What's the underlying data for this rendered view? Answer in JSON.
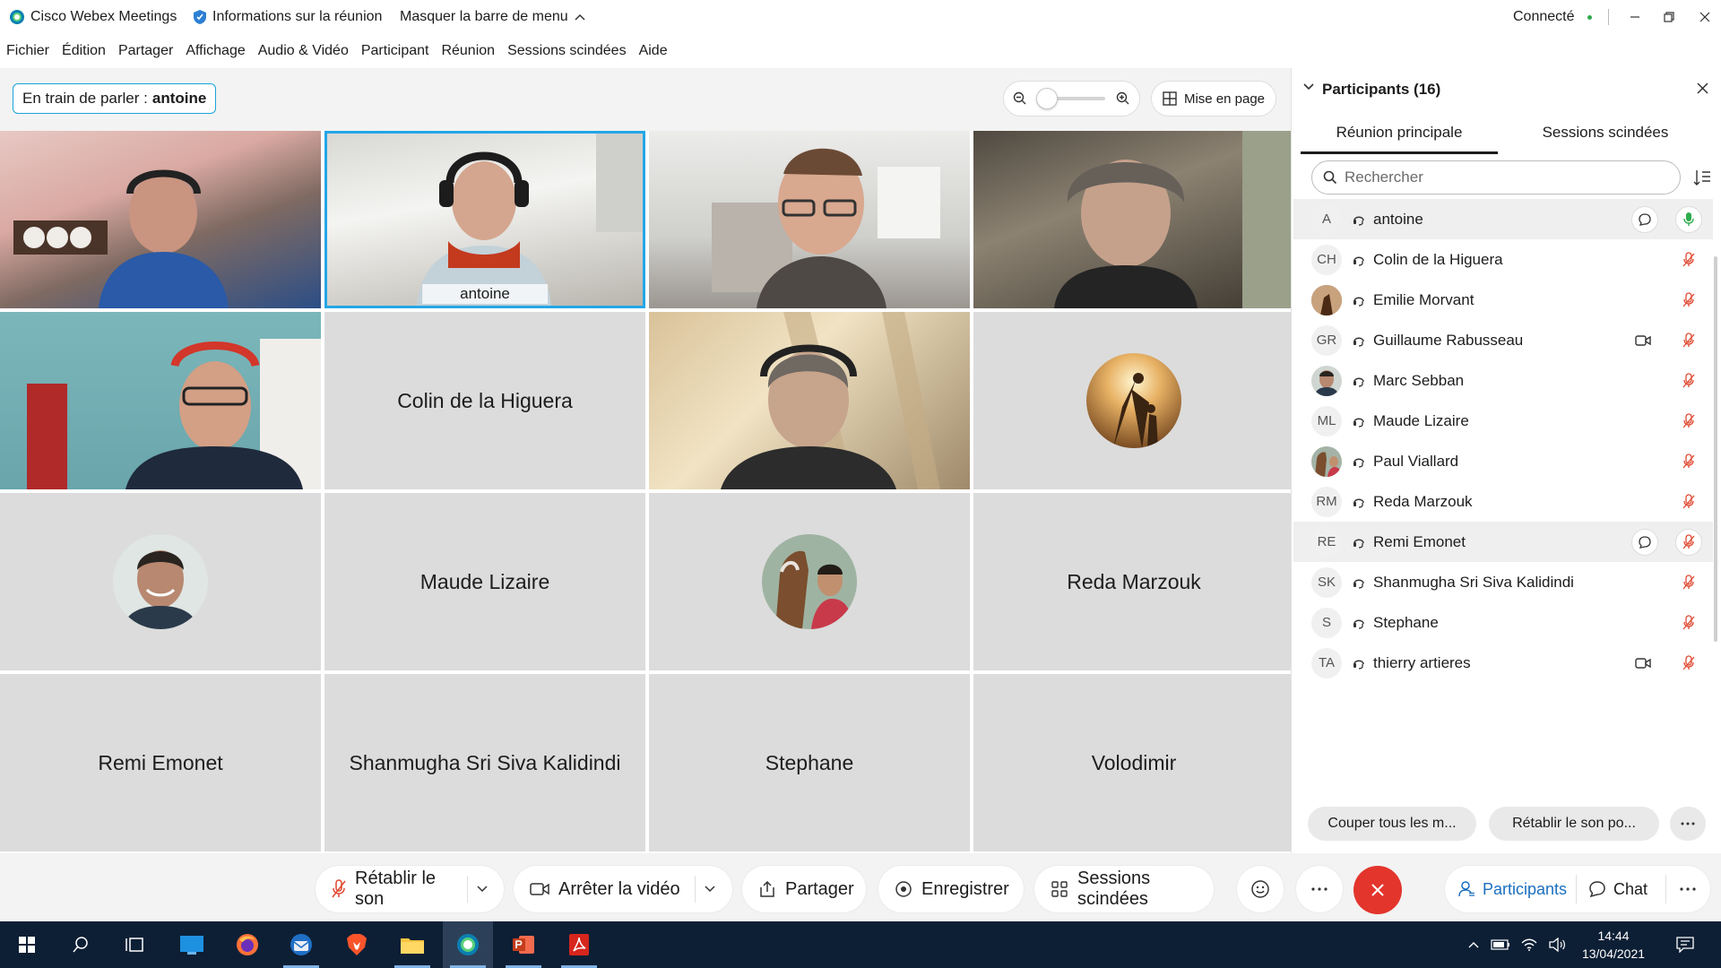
{
  "titlebar": {
    "app_name": "Cisco Webex Meetings",
    "meeting_info": "Informations sur la réunion",
    "hide_menu": "Masquer la barre de menu",
    "status": "Connecté"
  },
  "menu": [
    "Fichier",
    "Édition",
    "Partager",
    "Affichage",
    "Audio & Vidéo",
    "Participant",
    "Réunion",
    "Sessions scindées",
    "Aide"
  ],
  "speaking": {
    "prefix": "En train de parler :",
    "name": "antoine"
  },
  "layout_button": "Mise en page",
  "tiles": [
    {
      "name": "",
      "type": "video"
    },
    {
      "name": "antoine",
      "type": "video-active"
    },
    {
      "name": "",
      "type": "video"
    },
    {
      "name": "",
      "type": "video"
    },
    {
      "name": "",
      "type": "video"
    },
    {
      "name": "Colin de la Higuera",
      "type": "name"
    },
    {
      "name": "",
      "type": "video"
    },
    {
      "name": "",
      "type": "avatar"
    },
    {
      "name": "",
      "type": "avatar"
    },
    {
      "name": "Maude Lizaire",
      "type": "name"
    },
    {
      "name": "",
      "type": "avatar"
    },
    {
      "name": "Reda Marzouk",
      "type": "name"
    },
    {
      "name": "Remi Emonet",
      "type": "name"
    },
    {
      "name": "Shanmugha Sri Siva Kalidindi",
      "type": "name"
    },
    {
      "name": "Stephane",
      "type": "name"
    },
    {
      "name": "Volodimir",
      "type": "name"
    }
  ],
  "panel": {
    "title": "Participants (16)",
    "tabs": [
      "Réunion principale",
      "Sessions scindées"
    ],
    "search_placeholder": "Rechercher",
    "participants": [
      {
        "initials": "A",
        "name": "antoine",
        "chat": true,
        "video": false,
        "mic": "on"
      },
      {
        "initials": "CH",
        "name": "Colin de la Higuera",
        "chat": false,
        "video": false,
        "mic": "muted"
      },
      {
        "initials": "",
        "name": "Emilie Morvant",
        "chat": false,
        "video": false,
        "mic": "muted"
      },
      {
        "initials": "GR",
        "name": "Guillaume Rabusseau",
        "chat": false,
        "video": true,
        "mic": "muted"
      },
      {
        "initials": "",
        "name": "Marc Sebban",
        "chat": false,
        "video": false,
        "mic": "muted"
      },
      {
        "initials": "ML",
        "name": "Maude Lizaire",
        "chat": false,
        "video": false,
        "mic": "muted"
      },
      {
        "initials": "",
        "name": "Paul Viallard",
        "chat": false,
        "video": false,
        "mic": "muted"
      },
      {
        "initials": "RM",
        "name": "Reda Marzouk",
        "chat": false,
        "video": false,
        "mic": "muted"
      },
      {
        "initials": "RE",
        "name": "Remi Emonet",
        "chat": true,
        "video": false,
        "mic": "muted"
      },
      {
        "initials": "SK",
        "name": "Shanmugha Sri Siva Kalidindi",
        "chat": false,
        "video": false,
        "mic": "muted"
      },
      {
        "initials": "S",
        "name": "Stephane",
        "chat": false,
        "video": false,
        "mic": "muted"
      },
      {
        "initials": "TA",
        "name": "thierry artieres",
        "chat": false,
        "video": true,
        "mic": "muted"
      }
    ],
    "mute_all": "Couper tous les m...",
    "unmute_all": "Rétablir le son po..."
  },
  "controls": {
    "unmute": "Rétablir le son",
    "stop_video": "Arrêter la vidéo",
    "share": "Partager",
    "record": "Enregistrer",
    "breakout": "Sessions scindées",
    "participants": "Participants",
    "chat": "Chat"
  },
  "taskbar": {
    "time": "14:44",
    "date": "13/04/2021"
  },
  "colors": {
    "accent": "#25a6e6",
    "end_call": "#e3352c",
    "muted_mic": "#e0472f",
    "active_mic": "#2eab4e",
    "taskbar": "#0d1f35",
    "status_dot": "#2eab4e"
  }
}
